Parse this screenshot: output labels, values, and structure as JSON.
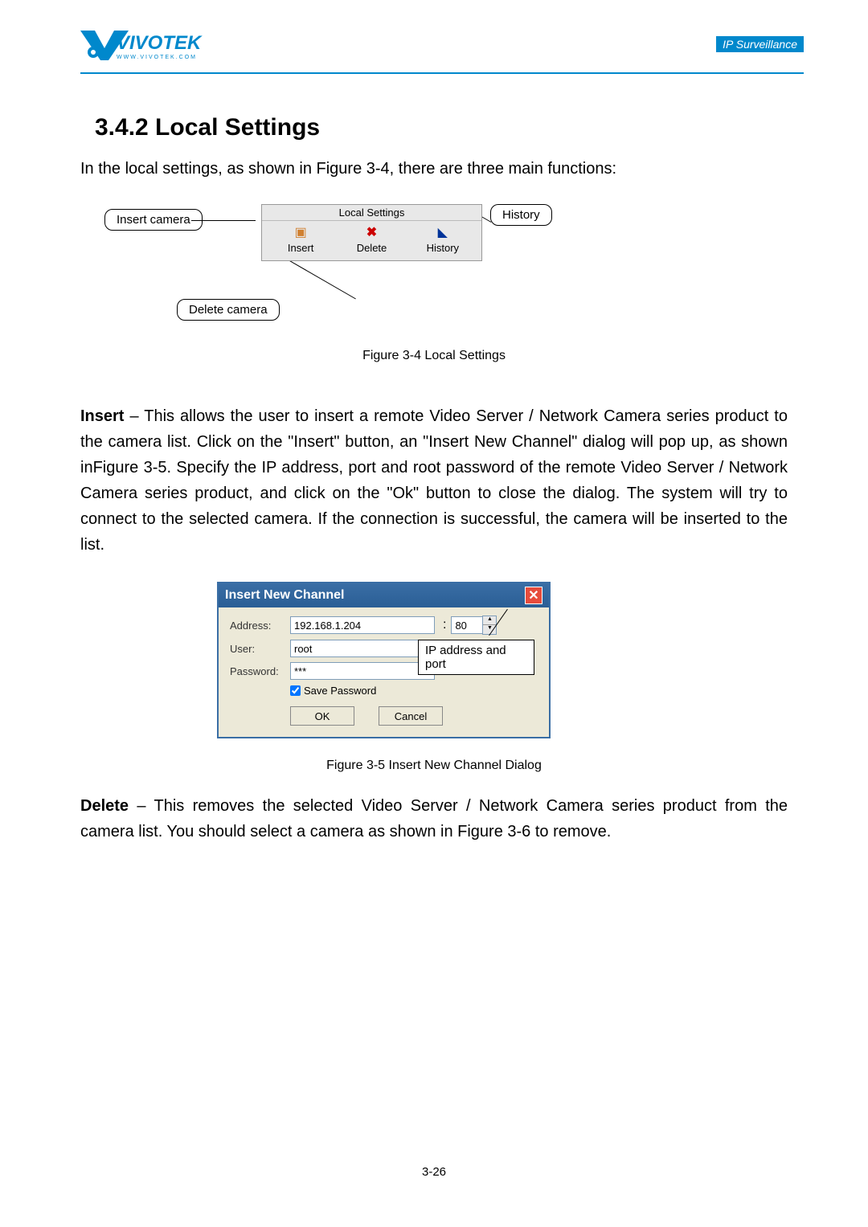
{
  "header": {
    "logo_text": "VIVOTEK",
    "logo_sub": "WWW.VIVOTEK.COM",
    "right_text": "IP Surveillance"
  },
  "section": {
    "heading": "3.4.2  Local Settings",
    "intro": "In the local settings, as shown in Figure 3-4, there are three main functions:"
  },
  "figure1": {
    "callout_insert": "Insert camera",
    "callout_history": "History",
    "callout_delete": "Delete camera",
    "panel_title": "Local Settings",
    "btn_insert": "Insert",
    "btn_delete": "Delete",
    "btn_history": "History",
    "caption": "Figure 3-4 Local Settings"
  },
  "para1": {
    "bold": "Insert",
    "text": " – This allows the user to insert a remote Video Server / Network Camera series product to the camera list. Click on the \"Insert\" button, an \"Insert New Channel\" dialog will pop up, as shown inFigure 3-5. Specify the IP address, port and root password of the remote Video Server / Network Camera series product, and click on the \"Ok\" button to close the dialog. The system will try to connect to the selected camera. If the connection is successful, the camera will be inserted to the list."
  },
  "dialog": {
    "title": "Insert New Channel",
    "label_address": "Address:",
    "label_user": "User:",
    "label_password": "Password:",
    "value_address": "192.168.1.204",
    "value_port": "80",
    "value_user": "root",
    "value_password": "***",
    "check_label": "Save Password",
    "btn_ok": "OK",
    "btn_cancel": "Cancel",
    "annot_ipport": "IP address and port"
  },
  "figure2_caption": "Figure 3-5    Insert New Channel Dialog",
  "para2": {
    "bold": "Delete",
    "text": " – This removes the selected Video Server / Network Camera series product from the camera list. You should select a camera as shown in Figure 3-6 to remove."
  },
  "page_number": "3-26"
}
